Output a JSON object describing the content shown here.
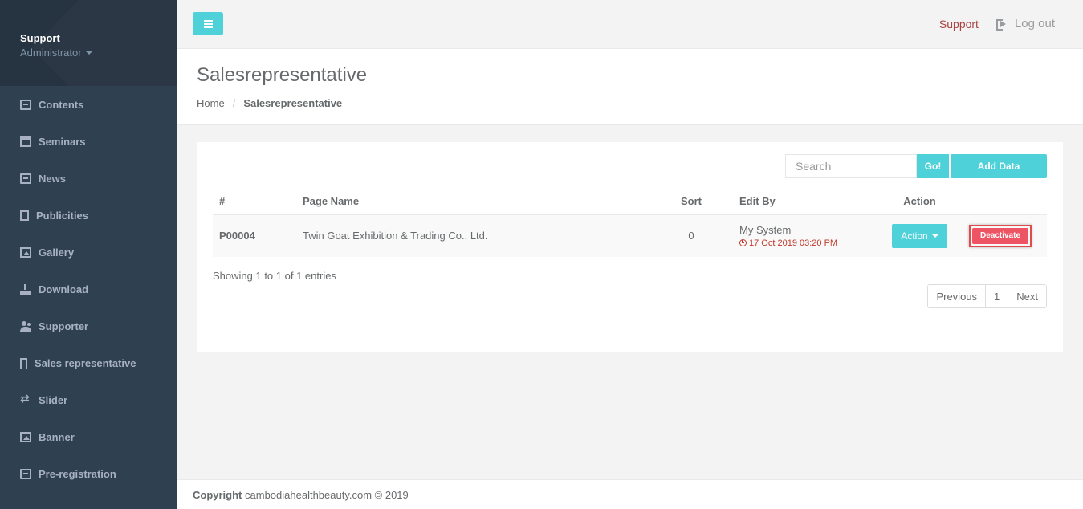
{
  "profile": {
    "name": "Support",
    "role": "Administrator"
  },
  "sidebar": {
    "items": [
      {
        "label": "Contents",
        "icon": "list-icon"
      },
      {
        "label": "Seminars",
        "icon": "calendar-icon"
      },
      {
        "label": "News",
        "icon": "newspaper-icon"
      },
      {
        "label": "Publicities",
        "icon": "document-icon"
      },
      {
        "label": "Gallery",
        "icon": "photo-icon"
      },
      {
        "label": "Download",
        "icon": "download-icon"
      },
      {
        "label": "Supporter",
        "icon": "users-icon"
      },
      {
        "label": "Sales representative",
        "icon": "bookmark-icon"
      },
      {
        "label": "Slider",
        "icon": "shuffle-icon"
      },
      {
        "label": "Banner",
        "icon": "picture-icon"
      },
      {
        "label": "Pre-registration",
        "icon": "list-icon"
      }
    ]
  },
  "topbar": {
    "support_label": "Support",
    "logout_label": "Log out"
  },
  "heading": {
    "title": "Salesrepresentative",
    "breadcrumb_home": "Home",
    "breadcrumb_sep": "/",
    "breadcrumb_active": "Salesrepresentative"
  },
  "toolbar": {
    "search_placeholder": "Search",
    "go_label": "Go!",
    "add_label": "Add Data"
  },
  "table": {
    "headers": {
      "id": "#",
      "name": "Page Name",
      "sort": "Sort",
      "edit_by": "Edit By",
      "action": "Action"
    },
    "rows": [
      {
        "id": "P00004",
        "name": "Twin Goat Exhibition & Trading Co., Ltd.",
        "sort": "0",
        "edit_by": "My System",
        "edit_time": "17 Oct 2019 03:20 PM",
        "action_label": "Action",
        "deactivate_label": "Deactivate"
      }
    ]
  },
  "pagination": {
    "info": "Showing 1 to 1 of 1 entries",
    "previous": "Previous",
    "current": "1",
    "next": "Next"
  },
  "footer": {
    "copyright_label": "Copyright",
    "copyright_text": "cambodiahealthbeauty.com © 2019"
  },
  "colors": {
    "accent": "#4fd1d9",
    "sidebar": "#2f4050",
    "danger": "#ed5565",
    "support_link": "#a94442"
  }
}
